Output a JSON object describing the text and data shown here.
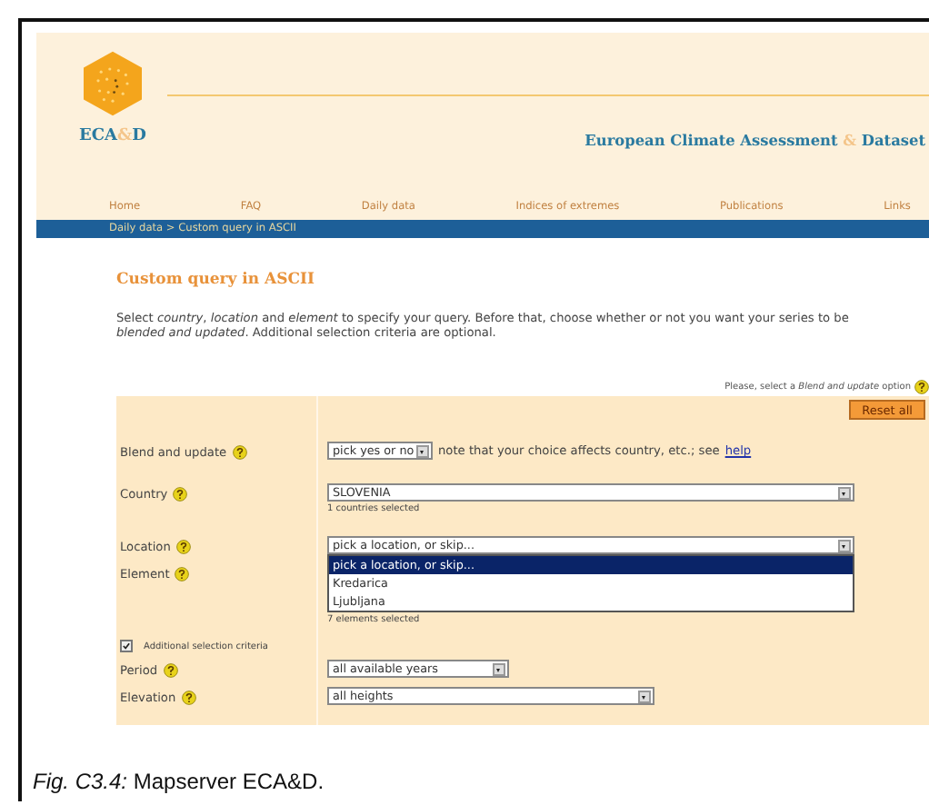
{
  "logo": {
    "parts": [
      {
        "text": "ECA",
        "accent": false
      },
      {
        "text": "&",
        "accent": true
      },
      {
        "text": "D",
        "accent": false
      }
    ]
  },
  "site_title": {
    "parts": [
      {
        "text": "European Climate Assessment ",
        "accent": false
      },
      {
        "text": "&",
        "accent": true
      },
      {
        "text": " Dataset",
        "accent": false
      }
    ]
  },
  "nav": [
    "Home",
    "FAQ",
    "Daily data",
    "Indices of extremes",
    "Publications",
    "Links"
  ],
  "breadcrumb": "Daily data > Custom query in ASCII",
  "heading": "Custom query in ASCII",
  "intro": "Select *country*, *location* and *element* to specify your query. Before that, choose whether or not you want your series to be *blended and updated*. Additional selection criteria are optional.",
  "hint": "Please, select a *Blend and update* option",
  "reset_button": "Reset all",
  "form": {
    "blend": {
      "label": "Blend and update",
      "value": "pick yes or no",
      "note": "note that your choice affects country, etc.; see",
      "link": "help"
    },
    "country": {
      "label": "Country",
      "value": "SLOVENIA",
      "count": "1 countries selected"
    },
    "location": {
      "label": "Location",
      "value": "pick a location, or skip...",
      "options": [
        {
          "text": "pick a location, or skip...",
          "selected": true
        },
        {
          "text": "Kredarica",
          "selected": false
        },
        {
          "text": "Ljubljana",
          "selected": false
        }
      ]
    },
    "element": {
      "label": "Element",
      "count": "7 elements selected"
    },
    "additional": {
      "label": "Additional selection criteria",
      "checked": true
    },
    "period": {
      "label": "Period",
      "value": "all available years"
    },
    "elevation": {
      "label": "Elevation",
      "value": "all heights"
    }
  },
  "caption": {
    "prefix": "Fig. C3.4:",
    "text": "Mapserver ECA&D."
  }
}
